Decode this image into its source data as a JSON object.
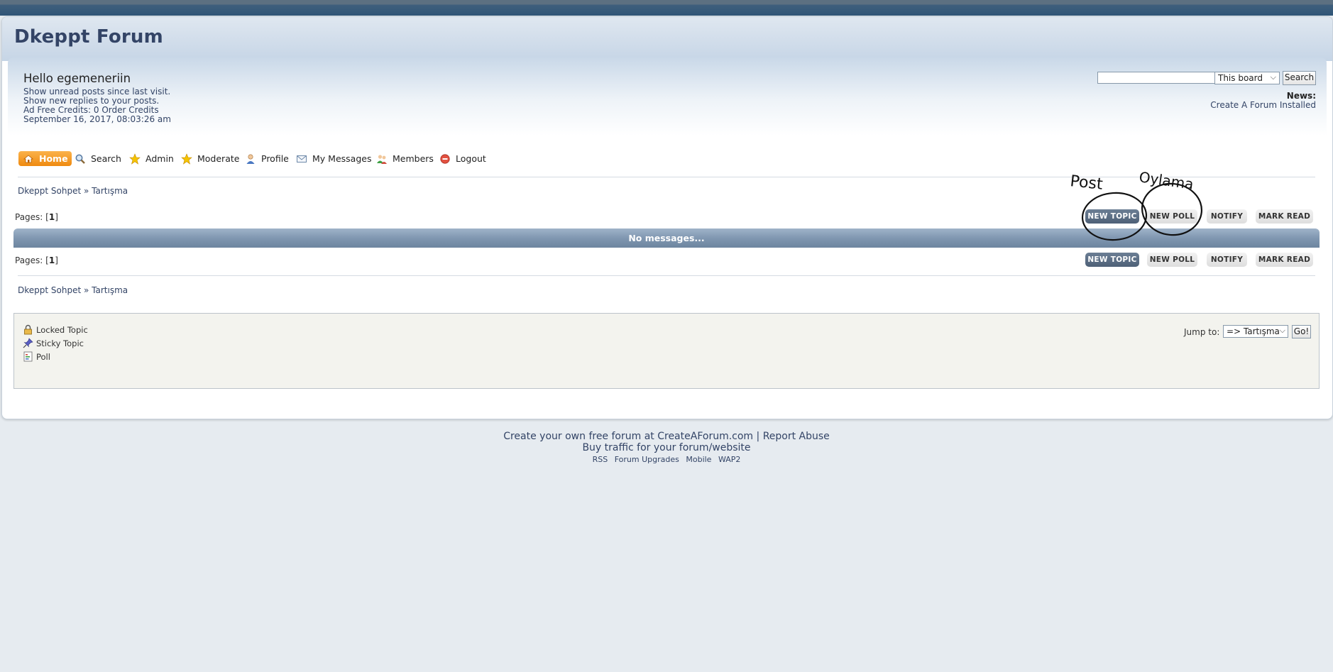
{
  "header": {
    "forum_title": "Dkeppt Forum"
  },
  "user_panel": {
    "greeting": "Hello egemeneriin",
    "lines": [
      "Show unread posts since last visit.",
      "Show new replies to your posts.",
      "Ad Free Credits: 0 Order Credits",
      "September 16, 2017, 08:03:26 am"
    ]
  },
  "search": {
    "input_value": "",
    "scope": "This board",
    "button": "Search"
  },
  "news": {
    "label": "News:",
    "text": "Create A Forum Installed"
  },
  "menu": {
    "home": "Home",
    "search": "Search",
    "admin": "Admin",
    "moderate": "Moderate",
    "profile": "Profile",
    "messages": "My Messages",
    "members": "Members",
    "logout": "Logout"
  },
  "breadcrumb": {
    "board": "Dkeppt Sohpet",
    "separator": "»",
    "category": "Tartışma"
  },
  "pages": {
    "label": "Pages: [",
    "current": "1",
    "close": "]"
  },
  "buttons": {
    "new_topic": "NEW TOPIC",
    "new_poll": "NEW POLL",
    "notify": "NOTIFY",
    "mark_read": "MARK READ"
  },
  "topics": {
    "empty_message": "No messages..."
  },
  "legend": {
    "locked": "Locked Topic",
    "sticky": "Sticky Topic",
    "poll": "Poll"
  },
  "jump": {
    "label": "Jump to:",
    "selected": "=> Tartışma",
    "go": "Go!"
  },
  "footer": {
    "line1_link": "Create your own free forum at CreateAForum.com",
    "line1_sep": "|",
    "line1_report": "Report Abuse",
    "line2": "Buy traffic for your forum/website",
    "links": [
      "RSS",
      "Forum Upgrades",
      "Mobile",
      "WAP2"
    ]
  },
  "annotations": {
    "post": "Post",
    "oylama": "Oylama"
  },
  "colors": {
    "accent_orange": "#ef8a10",
    "header_blue": "#334466",
    "catbar": "#7f96b0",
    "dark_button": "#4e6077"
  }
}
